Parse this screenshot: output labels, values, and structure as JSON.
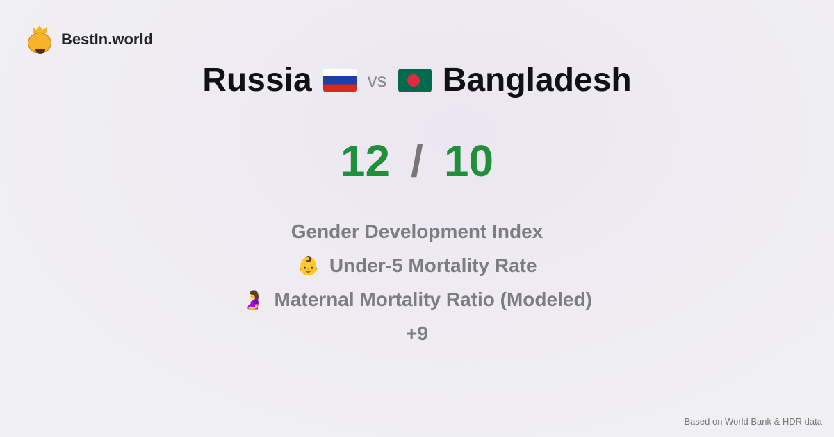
{
  "brand": {
    "name": "BestIn.world"
  },
  "comparison": {
    "left": {
      "name": "Russia",
      "flag": "russia-flag"
    },
    "vs": "vs",
    "right": {
      "name": "Bangladesh",
      "flag": "bangladesh-flag"
    }
  },
  "score": {
    "left": "12",
    "separator": "/",
    "right": "10",
    "color": "#1f8f3a"
  },
  "metrics": [
    {
      "label": "Gender Development Index",
      "icon": ""
    },
    {
      "label": "Under-5 Mortality Rate",
      "icon": "👶"
    },
    {
      "label": "Maternal Mortality Ratio (Modeled)",
      "icon": "🤰"
    }
  ],
  "more": "+9",
  "footer": "Based on World Bank & HDR data"
}
